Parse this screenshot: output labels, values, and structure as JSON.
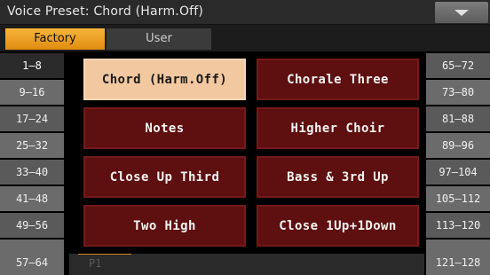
{
  "window": {
    "title": "Voice Preset: Chord (Harm.Off)"
  },
  "tabs": [
    {
      "label": "Factory",
      "active": true
    },
    {
      "label": "User",
      "active": false
    }
  ],
  "left_pages": [
    "1–8",
    "9–16",
    "17–24",
    "25–32",
    "33–40",
    "41–48",
    "49–56",
    "57–64"
  ],
  "right_pages": [
    "65–72",
    "73–80",
    "81–88",
    "89–96",
    "97–104",
    "105–112",
    "113–120",
    "121–128"
  ],
  "selected_page_index": 0,
  "presets": [
    "Chord (Harm.Off)",
    "Chorale Three",
    "Notes",
    "Higher Choir",
    "Close Up Third",
    "Bass & 3rd Up",
    "Two High",
    "Close 1Up+1Down"
  ],
  "selected_preset_index": 0,
  "page_indicator": "P1",
  "colors": {
    "accent_orange": "#e8971a",
    "preset_bg": "#5e0f0f",
    "preset_selected_bg": "#f2c8a0"
  },
  "icons": {
    "menu": "triangle-down-icon"
  }
}
